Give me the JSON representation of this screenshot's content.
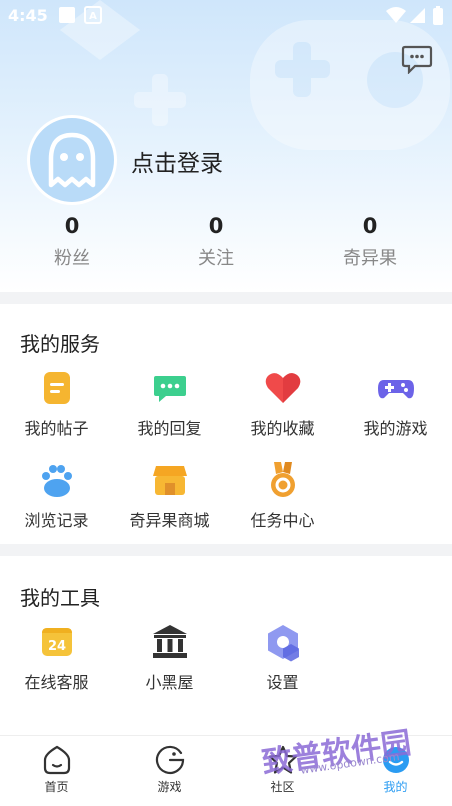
{
  "status_bar": {
    "time": "4:45"
  },
  "profile": {
    "login_label": "点击登录",
    "stats": [
      {
        "value": "0",
        "label": "粉丝"
      },
      {
        "value": "0",
        "label": "关注"
      },
      {
        "value": "0",
        "label": "奇异果"
      }
    ]
  },
  "services": {
    "title": "我的服务",
    "items": [
      {
        "label": "我的帖子",
        "icon": "document-icon",
        "color": "#f5b530"
      },
      {
        "label": "我的回复",
        "icon": "chat-bubble-icon",
        "color": "#3ccf8e"
      },
      {
        "label": "我的收藏",
        "icon": "heart-icon",
        "color": "#f04a4a"
      },
      {
        "label": "我的游戏",
        "icon": "gamepad-icon",
        "color": "#6c63e8"
      },
      {
        "label": "浏览记录",
        "icon": "paw-icon",
        "color": "#4ea3f0"
      },
      {
        "label": "奇异果商城",
        "icon": "store-icon",
        "color": "#f5a623"
      },
      {
        "label": "任务中心",
        "icon": "medal-icon",
        "color": "#f0a030"
      }
    ]
  },
  "tools": {
    "title": "我的工具",
    "items": [
      {
        "label": "在线客服",
        "icon": "calendar-24-icon",
        "badge": "24",
        "color": "#f5c33a"
      },
      {
        "label": "小黑屋",
        "icon": "building-icon",
        "color": "#333333"
      },
      {
        "label": "设置",
        "icon": "settings-hexagon-icon",
        "color": "#6c78e8"
      }
    ]
  },
  "tabbar": {
    "tabs": [
      {
        "label": "首页",
        "icon": "home-icon"
      },
      {
        "label": "游戏",
        "icon": "game-face-icon"
      },
      {
        "label": "社区",
        "icon": "star-icon"
      },
      {
        "label": "我的",
        "icon": "profile-bubble-icon",
        "active": true
      }
    ]
  },
  "watermark": {
    "text": "致普软件园",
    "url": "www.opdown.com"
  }
}
